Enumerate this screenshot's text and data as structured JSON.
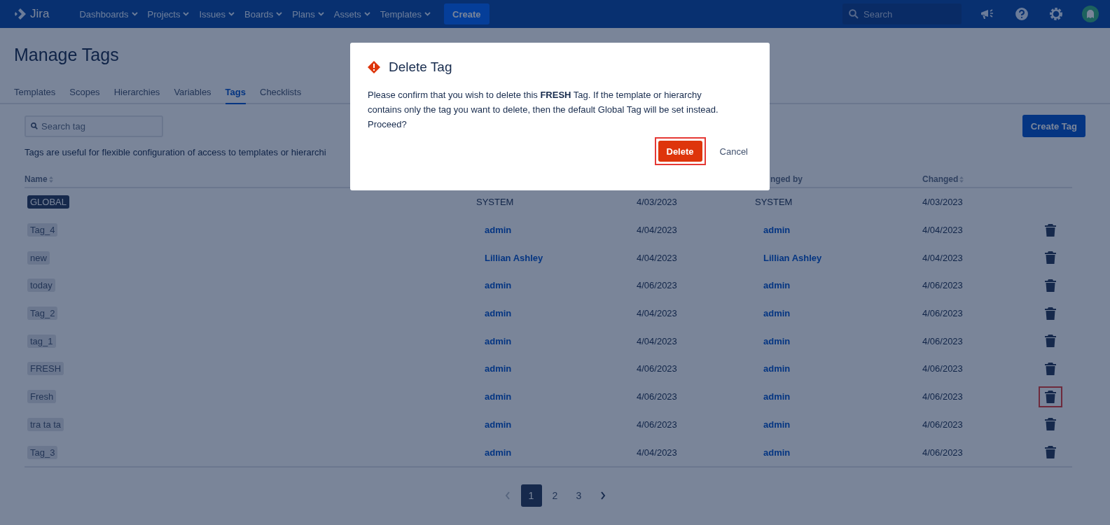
{
  "nav": {
    "logo": "Jira",
    "menus": [
      {
        "label": "Dashboards"
      },
      {
        "label": "Projects"
      },
      {
        "label": "Issues"
      },
      {
        "label": "Boards"
      },
      {
        "label": "Plans"
      },
      {
        "label": "Assets"
      },
      {
        "label": "Templates"
      }
    ],
    "create": "Create",
    "search": {
      "placeholder": "Search"
    }
  },
  "page": {
    "title": "Manage Tags",
    "tabs": [
      {
        "label": "Templates",
        "selected": false
      },
      {
        "label": "Scopes",
        "selected": false
      },
      {
        "label": "Hierarchies",
        "selected": false
      },
      {
        "label": "Variables",
        "selected": false
      },
      {
        "label": "Tags",
        "selected": true
      },
      {
        "label": "Checklists",
        "selected": false
      }
    ],
    "search": {
      "placeholder": "Search tag"
    },
    "create_button": "Create Tag",
    "description": "Tags are useful for flexible configuration of access to templates or hierarchi"
  },
  "table": {
    "columns": [
      {
        "label": "Name",
        "sortable": true
      },
      {},
      {},
      {
        "label": "nged by",
        "sortable": false
      },
      {
        "label": "Changed",
        "sortable": true
      }
    ],
    "rows": [
      {
        "name": "GLOBAL",
        "default": true,
        "created_by": {
          "text": "SYSTEM",
          "link": false
        },
        "created": "4/03/2023",
        "changed_by": {
          "text": "SYSTEM",
          "link": false
        },
        "changed": "4/03/2023",
        "deletable": false
      },
      {
        "name": "Tag_4",
        "default": false,
        "created_by": {
          "text": "admin",
          "link": true
        },
        "created": "4/04/2023",
        "changed_by": {
          "text": "admin",
          "link": true
        },
        "changed": "4/04/2023",
        "deletable": true,
        "highlighted": false
      },
      {
        "name": "new",
        "default": false,
        "created_by": {
          "text": "Lillian Ashley",
          "link": true
        },
        "created": "4/04/2023",
        "changed_by": {
          "text": "Lillian Ashley",
          "link": true
        },
        "changed": "4/04/2023",
        "deletable": true,
        "highlighted": false
      },
      {
        "name": "today",
        "default": false,
        "created_by": {
          "text": "admin",
          "link": true
        },
        "created": "4/06/2023",
        "changed_by": {
          "text": "admin",
          "link": true
        },
        "changed": "4/06/2023",
        "deletable": true,
        "highlighted": false
      },
      {
        "name": "Tag_2",
        "default": false,
        "created_by": {
          "text": "admin",
          "link": true
        },
        "created": "4/04/2023",
        "changed_by": {
          "text": "admin",
          "link": true
        },
        "changed": "4/06/2023",
        "deletable": true,
        "highlighted": false
      },
      {
        "name": "tag_1",
        "default": false,
        "created_by": {
          "text": "admin",
          "link": true
        },
        "created": "4/04/2023",
        "changed_by": {
          "text": "admin",
          "link": true
        },
        "changed": "4/06/2023",
        "deletable": true,
        "highlighted": false
      },
      {
        "name": "FRESH",
        "default": false,
        "created_by": {
          "text": "admin",
          "link": true
        },
        "created": "4/06/2023",
        "changed_by": {
          "text": "admin",
          "link": true
        },
        "changed": "4/06/2023",
        "deletable": true,
        "highlighted": false
      },
      {
        "name": "Fresh",
        "default": false,
        "created_by": {
          "text": "admin",
          "link": true
        },
        "created": "4/06/2023",
        "changed_by": {
          "text": "admin",
          "link": true
        },
        "changed": "4/06/2023",
        "deletable": true,
        "highlighted": true
      },
      {
        "name": "tra ta ta",
        "default": false,
        "created_by": {
          "text": "admin",
          "link": true
        },
        "created": "4/06/2023",
        "changed_by": {
          "text": "admin",
          "link": true
        },
        "changed": "4/06/2023",
        "deletable": true,
        "highlighted": false
      },
      {
        "name": "Tag_3",
        "default": false,
        "created_by": {
          "text": "admin",
          "link": true
        },
        "created": "4/04/2023",
        "changed_by": {
          "text": "admin",
          "link": true
        },
        "changed": "4/06/2023",
        "deletable": true,
        "highlighted": false
      }
    ]
  },
  "pagination": {
    "pages": [
      {
        "label": "1",
        "selected": true
      },
      {
        "label": "2",
        "selected": false
      },
      {
        "label": "3",
        "selected": false
      }
    ],
    "prev_disabled": true
  },
  "dialog": {
    "title": "Delete Tag",
    "message": "Please confirm that you wish to delete this **FRESH** Tag. If the template or hierarchy contains only the tag you want to delete, then the default Global Tag will be set instead. Proceed?",
    "confirm": {
      "label": "Delete",
      "highlighted": true
    },
    "cancel": "Cancel"
  }
}
